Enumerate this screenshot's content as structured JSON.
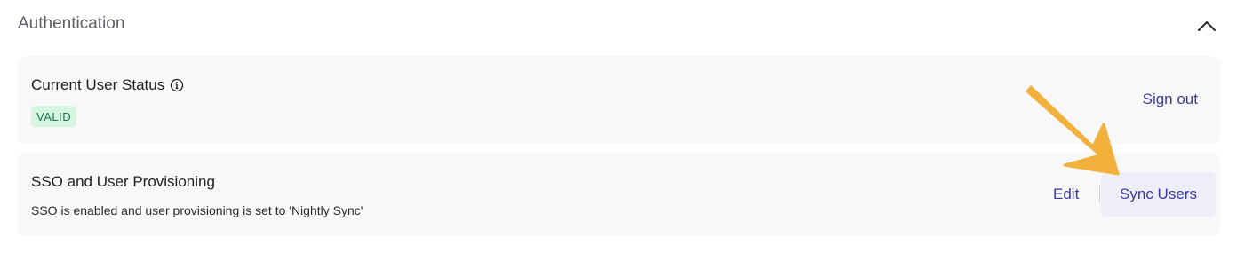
{
  "section": {
    "title": "Authentication",
    "collapse_icon": "chevron-up-icon"
  },
  "status_card": {
    "title": "Current User Status",
    "info_icon": "info-icon",
    "badge": "VALID",
    "sign_out_label": "Sign out"
  },
  "sso_card": {
    "title": "SSO and User Provisioning",
    "description": "SSO is enabled and user provisioning is set to 'Nightly Sync'",
    "edit_label": "Edit",
    "sync_label": "Sync Users"
  },
  "colors": {
    "accent": "#3a3a9e",
    "badge_bg": "#d6f5e3",
    "badge_text": "#1a7a45",
    "annotation_arrow": "#f2b13c"
  }
}
